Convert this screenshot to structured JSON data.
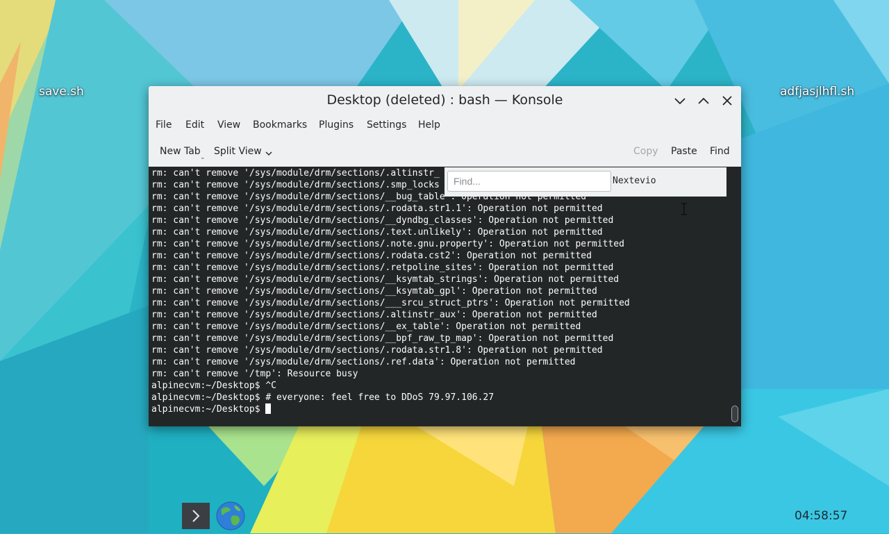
{
  "desktop": {
    "icons": [
      {
        "label": "save.sh"
      },
      {
        "label": "adfjasjlhfl.sh"
      }
    ]
  },
  "window": {
    "title": "Desktop (deleted) : bash — Konsole",
    "controls": {
      "minimize": "chevron-down-icon",
      "maximize": "chevron-up-icon",
      "close": "close-icon"
    }
  },
  "menubar": {
    "items": [
      "File",
      "Edit",
      "View",
      "Bookmarks",
      "Plugins",
      "Settings",
      "Help"
    ]
  },
  "toolbar": {
    "new_tab": "New Tab",
    "split_view": "Split View",
    "copy": "Copy",
    "paste": "Paste",
    "find": "Find"
  },
  "findbar": {
    "placeholder": "Find...",
    "value": "",
    "extra_text": "Nextevio"
  },
  "terminal": {
    "lines": [
      "rm: can't remove '/sys/module/drm/sections/.altinstr_",
      "rm: can't remove '/sys/module/drm/sections/.smp_locks",
      "rm: can't remove '/sys/module/drm/sections/__bug_table': Operation not permitted",
      "rm: can't remove '/sys/module/drm/sections/.rodata.str1.1': Operation not permitted",
      "rm: can't remove '/sys/module/drm/sections/__dyndbg_classes': Operation not permitted",
      "rm: can't remove '/sys/module/drm/sections/.text.unlikely': Operation not permitted",
      "rm: can't remove '/sys/module/drm/sections/.note.gnu.property': Operation not permitted",
      "rm: can't remove '/sys/module/drm/sections/.rodata.cst2': Operation not permitted",
      "rm: can't remove '/sys/module/drm/sections/.retpoline_sites': Operation not permitted",
      "rm: can't remove '/sys/module/drm/sections/__ksymtab_strings': Operation not permitted",
      "rm: can't remove '/sys/module/drm/sections/__ksymtab_gpl': Operation not permitted",
      "rm: can't remove '/sys/module/drm/sections/___srcu_struct_ptrs': Operation not permitted",
      "rm: can't remove '/sys/module/drm/sections/.altinstr_aux': Operation not permitted",
      "rm: can't remove '/sys/module/drm/sections/__ex_table': Operation not permitted",
      "rm: can't remove '/sys/module/drm/sections/__bpf_raw_tp_map': Operation not permitted",
      "rm: can't remove '/sys/module/drm/sections/.rodata.str1.8': Operation not permitted",
      "rm: can't remove '/sys/module/drm/sections/.ref.data': Operation not permitted",
      "rm: can't remove '/tmp': Resource busy",
      "alpinecvm:~/Desktop$ ^C",
      "alpinecvm:~/Desktop$ # everyone: feel free to DDoS 79.97.106.27"
    ],
    "prompt": "alpinecvm:~/Desktop$ "
  },
  "taskbar": {
    "launcher_icon": "chevron-right-icon",
    "browser_icon": "globe-icon",
    "clock": "04:58:57"
  },
  "colors": {
    "terminal_bg": "#232627",
    "terminal_fg": "#fcfcfc",
    "window_bg": "#eff0f1"
  }
}
